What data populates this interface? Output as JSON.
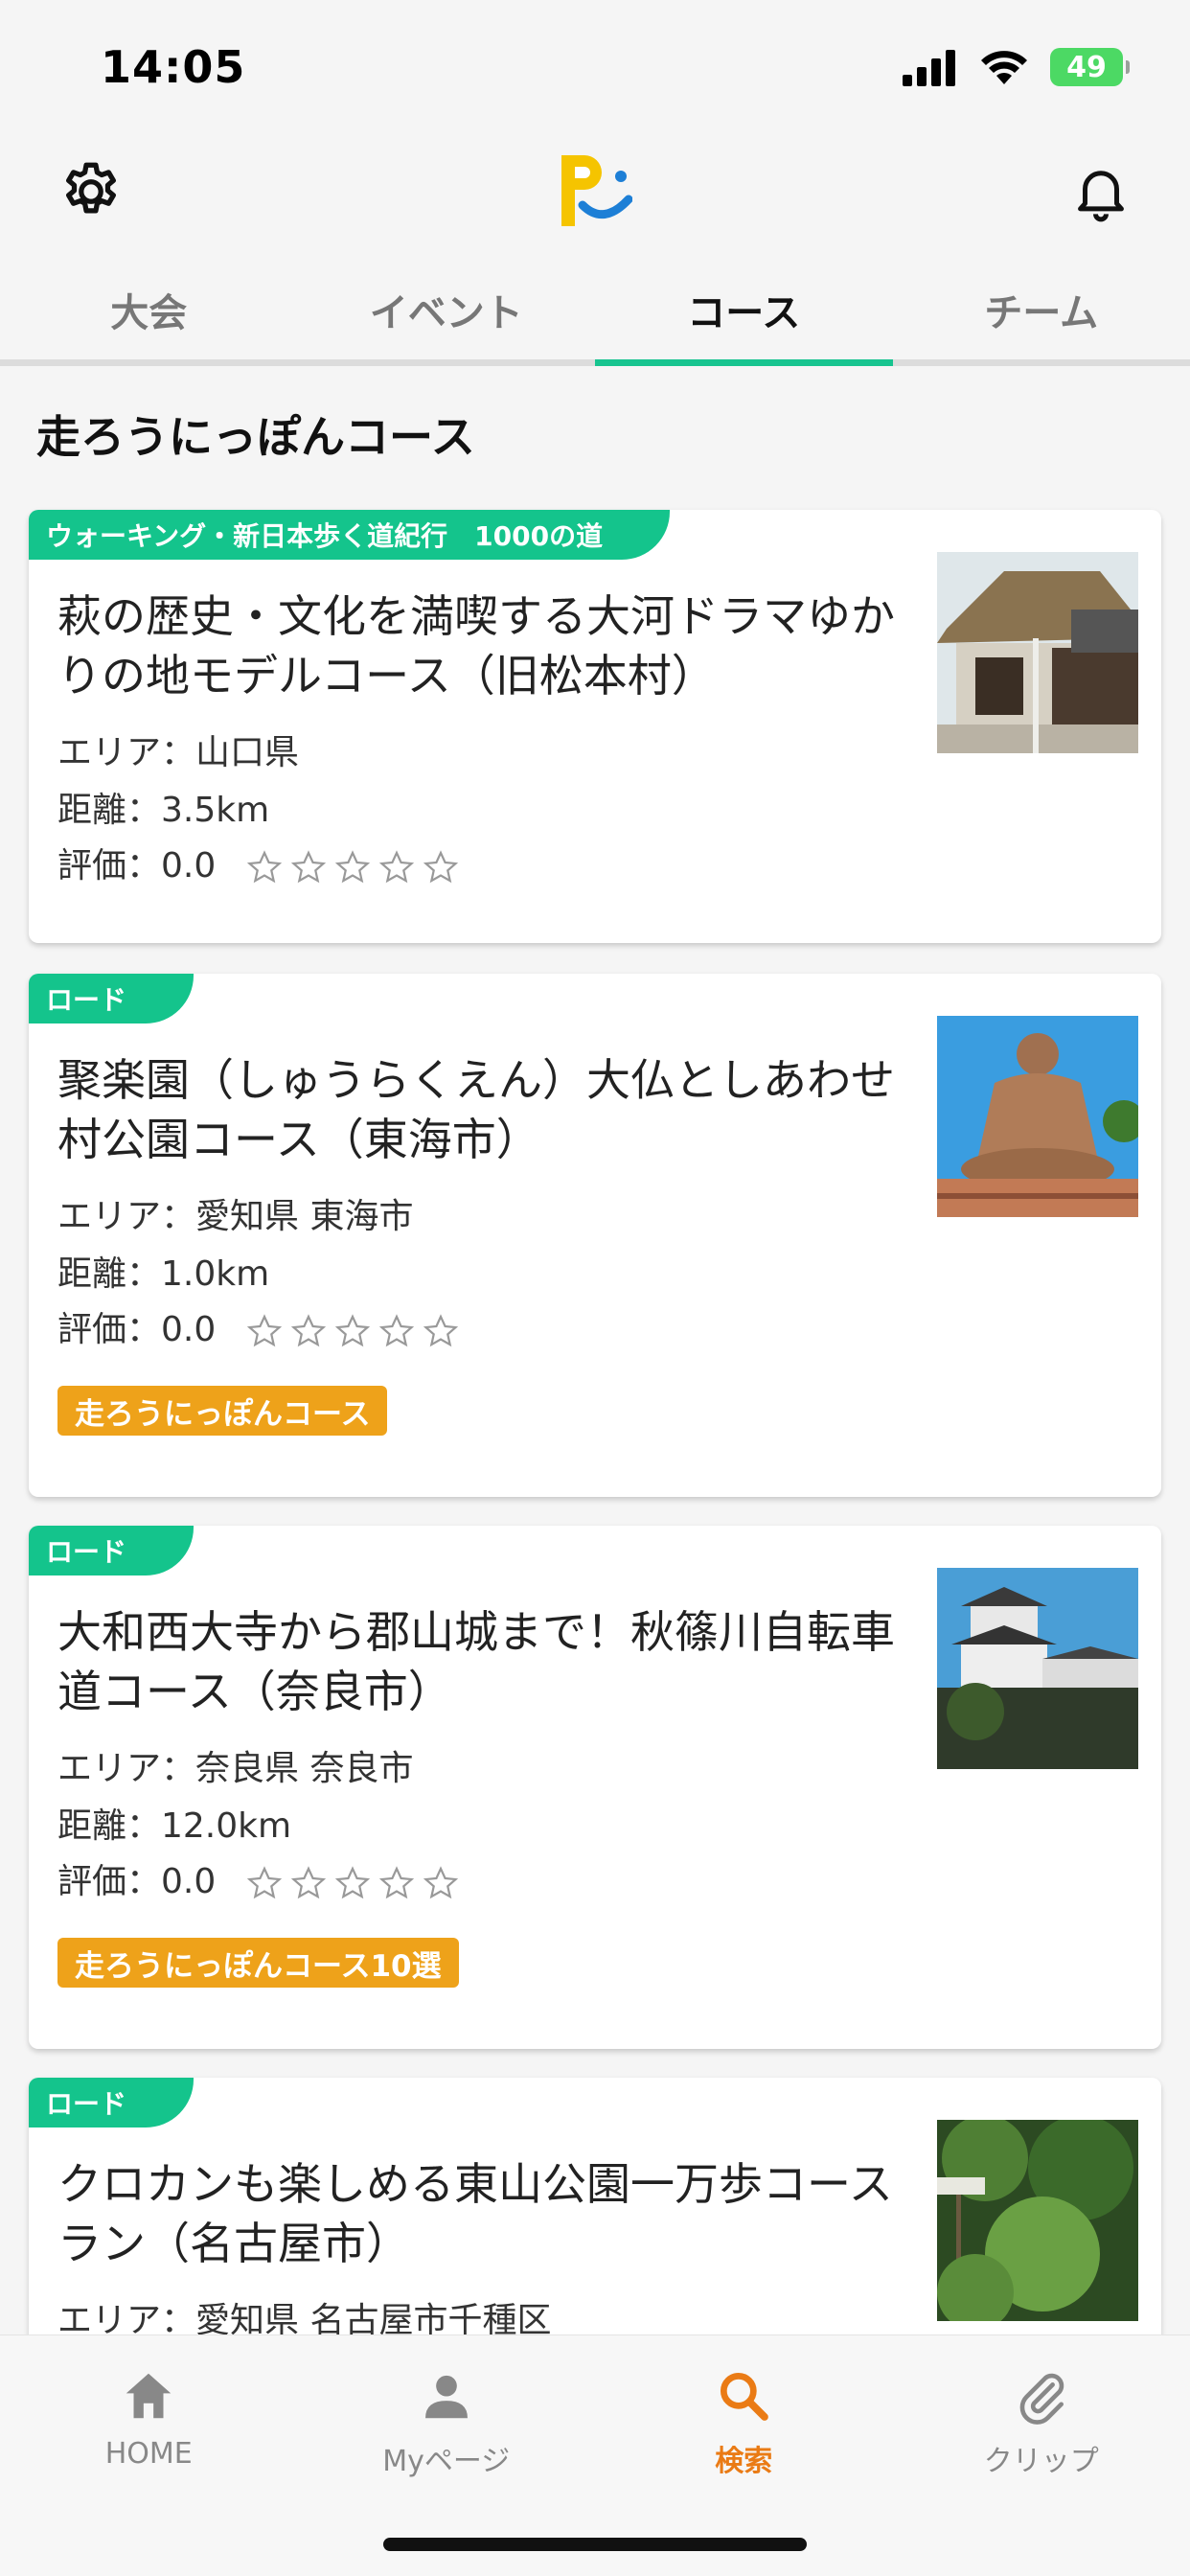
{
  "status_bar": {
    "time": "14:05",
    "battery": "49"
  },
  "tabs": [
    {
      "label": "大会",
      "active": false
    },
    {
      "label": "イベント",
      "active": false
    },
    {
      "label": "コース",
      "active": true
    },
    {
      "label": "チーム",
      "active": false
    }
  ],
  "section_title": "走ろうにっぽんコース",
  "cards": [
    {
      "ribbon": "ウォーキング・新日本歩く道紀行　1000の道",
      "title": "萩の歴史・文化を満喫する大河ドラマゆかりの地モデルコース（旧松本村）",
      "area": "エリア：山口県",
      "distance": "距離：3.5km",
      "rating": "評価：0.0",
      "rating_value": 0.0,
      "image": "thatched-house-photo"
    },
    {
      "ribbon": "ロード",
      "title": "聚楽園（しゅうらくえん）大仏としあわせ村公園コース（東海市）",
      "area": "エリア：愛知県 東海市",
      "distance": "距離：1.0km",
      "rating": "評価：0.0",
      "rating_value": 0.0,
      "tag": "走ろうにっぽんコース",
      "image": "great-buddha-photo"
    },
    {
      "ribbon": "ロード",
      "title": "大和西大寺から郡山城まで！秋篠川自転車道コース（奈良市）",
      "area": "エリア：奈良県 奈良市",
      "distance": "距離：12.0km",
      "rating": "評価：0.0",
      "rating_value": 0.0,
      "tag": "走ろうにっぽんコース10選",
      "image": "castle-photo"
    },
    {
      "ribbon": "ロード",
      "title": "クロカンも楽しめる東山公園一万歩コースラン（名古屋市）",
      "area": "エリア：愛知県 名古屋市千種区",
      "image": "park-trail-photo"
    }
  ],
  "bottom_nav": [
    {
      "label": "HOME",
      "icon": "home-icon",
      "active": false
    },
    {
      "label": "Myページ",
      "icon": "person-icon",
      "active": false
    },
    {
      "label": "検索",
      "icon": "search-icon",
      "active": true
    },
    {
      "label": "クリップ",
      "icon": "paperclip-icon",
      "active": false
    }
  ],
  "colors": {
    "accent_green": "#14c48c",
    "tag_orange": "#eea21a",
    "nav_active": "#ea7b15"
  }
}
